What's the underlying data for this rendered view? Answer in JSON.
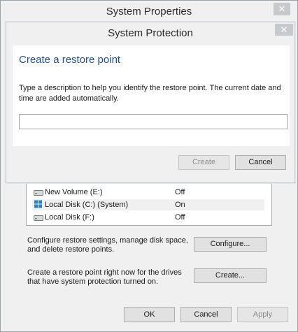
{
  "outer_window": {
    "title": "System Properties",
    "close_glyph": "✕"
  },
  "drives": [
    {
      "name": "New Volume (E:)",
      "status": "Off",
      "icon": "drive-icon",
      "selected": false
    },
    {
      "name": "Local Disk (C:) (System)",
      "status": "On",
      "icon": "system-drive-icon",
      "selected": true
    },
    {
      "name": "Local Disk (F:)",
      "status": "Off",
      "icon": "drive-icon",
      "selected": false
    }
  ],
  "configure_section": {
    "text": "Configure restore settings, manage disk space, and delete restore points.",
    "button_label": "Configure..."
  },
  "create_section": {
    "text": "Create a restore point right now for the drives that have system protection turned on.",
    "button_label": "Create..."
  },
  "footer": {
    "ok_label": "OK",
    "cancel_label": "Cancel",
    "apply_label": "Apply"
  },
  "inner_dialog": {
    "title": "System Protection",
    "close_glyph": "✕",
    "heading": "Create a restore point",
    "instructions": "Type a description to help you identify the restore point. The current date and time are added automatically.",
    "input_value": "",
    "create_label": "Create",
    "cancel_label": "Cancel"
  },
  "colors": {
    "heading": "#1f4f8f",
    "close_button": "#c7cacd",
    "window_bg": "#f0f0f0"
  }
}
